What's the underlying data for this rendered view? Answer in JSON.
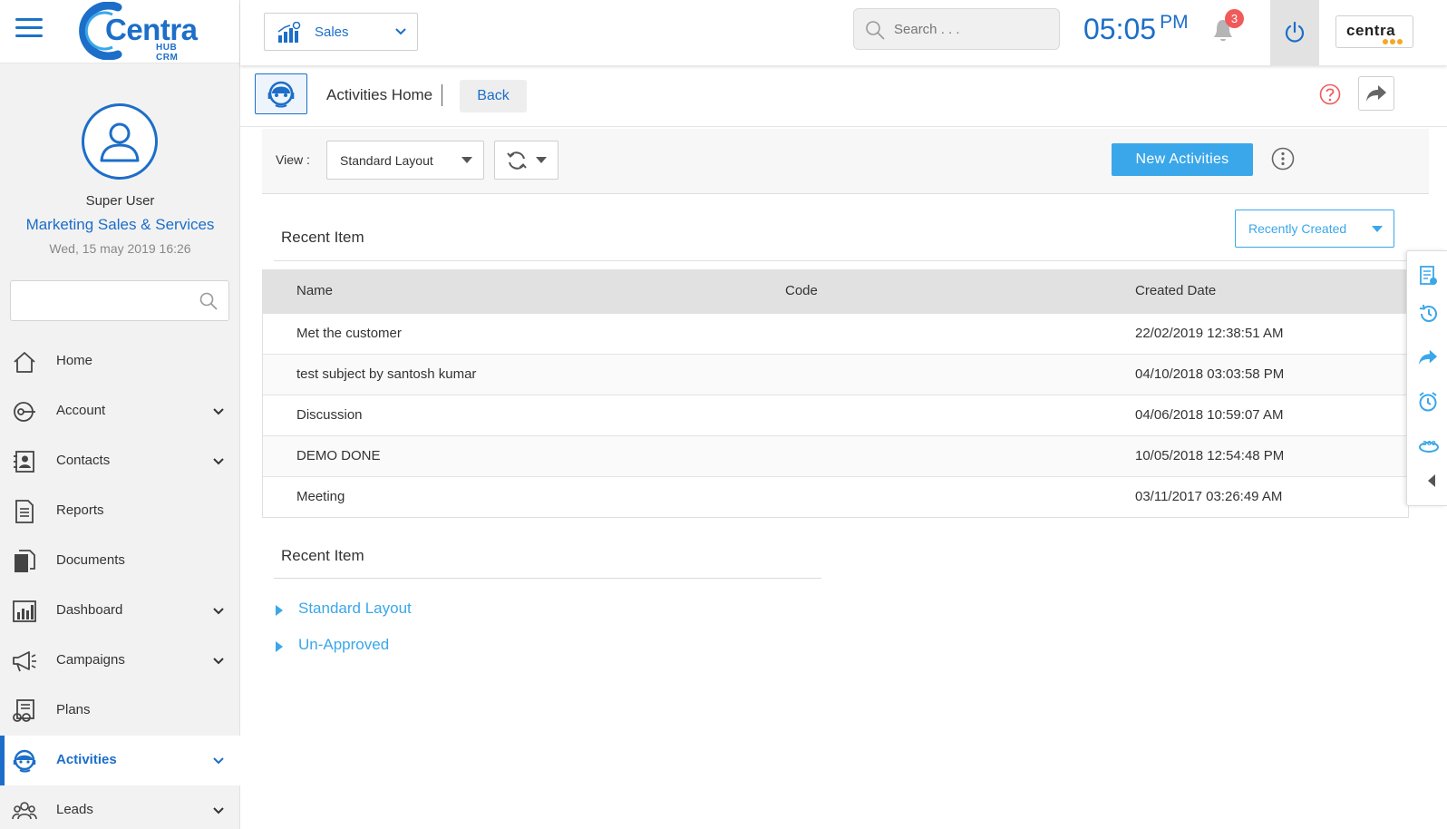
{
  "app": {
    "logo_text": "Centra",
    "logo_sub": "HUB CRM",
    "brand_text": "centra"
  },
  "colors": {
    "accent": "#1c6ec9",
    "button_blue": "#3aa7ea",
    "badge_red": "#f15a5a",
    "sidebar_bg": "#f2f2f2",
    "table_header_bg": "#e2e1e1"
  },
  "user": {
    "name": "Super User",
    "department": "Marketing Sales & Services",
    "datetime": "Wed, 15 may 2019 16:26"
  },
  "sidebar": {
    "search_placeholder": "",
    "items": [
      {
        "label": "Home",
        "icon": "home-icon",
        "has_chevron": false,
        "active": false
      },
      {
        "label": "Account",
        "icon": "account-icon",
        "has_chevron": true,
        "active": false
      },
      {
        "label": "Contacts",
        "icon": "contacts-icon",
        "has_chevron": true,
        "active": false
      },
      {
        "label": "Reports",
        "icon": "reports-icon",
        "has_chevron": false,
        "active": false
      },
      {
        "label": "Documents",
        "icon": "documents-icon",
        "has_chevron": false,
        "active": false
      },
      {
        "label": "Dashboard",
        "icon": "dashboard-icon",
        "has_chevron": true,
        "active": false
      },
      {
        "label": "Campaigns",
        "icon": "megaphone-icon",
        "has_chevron": true,
        "active": false
      },
      {
        "label": "Plans",
        "icon": "plans-icon",
        "has_chevron": false,
        "active": false
      },
      {
        "label": "Activities",
        "icon": "activities-icon",
        "has_chevron": true,
        "active": true
      },
      {
        "label": "Leads",
        "icon": "leads-icon",
        "has_chevron": true,
        "active": false
      }
    ]
  },
  "topbar": {
    "module": "Sales",
    "search_placeholder": "Search . . .",
    "time": "05:05",
    "ampm": "PM",
    "notification_count": "3"
  },
  "subheader": {
    "title": "Activities Home",
    "back_label": "Back"
  },
  "toolbar": {
    "view_label": "View :",
    "layout_value": "Standard Layout",
    "new_button": "New Activities"
  },
  "recent": {
    "heading": "Recent Item",
    "filter_value": "Recently Created",
    "columns": [
      "Name",
      "Code",
      "Created Date"
    ],
    "rows": [
      {
        "name": "Met the customer",
        "code": "",
        "created": "22/02/2019 12:38:51 AM"
      },
      {
        "name": "test subject by santosh kumar",
        "code": "",
        "created": "04/10/2018 03:03:58 PM"
      },
      {
        "name": "Discussion",
        "code": "",
        "created": "04/06/2018 10:59:07 AM"
      },
      {
        "name": "DEMO DONE",
        "code": "",
        "created": "10/05/2018 12:54:48 PM"
      },
      {
        "name": "Meeting",
        "code": "",
        "created": "03/11/2017 03:26:49 AM"
      }
    ]
  },
  "recent2": {
    "heading": "Recent Item",
    "items": [
      "Standard Layout",
      "Un-Approved"
    ]
  },
  "right_toolbar": {
    "icons": [
      "notes-icon",
      "history-icon",
      "forward-icon",
      "alarm-icon",
      "view-360-icon",
      "collapse-left-icon"
    ]
  }
}
